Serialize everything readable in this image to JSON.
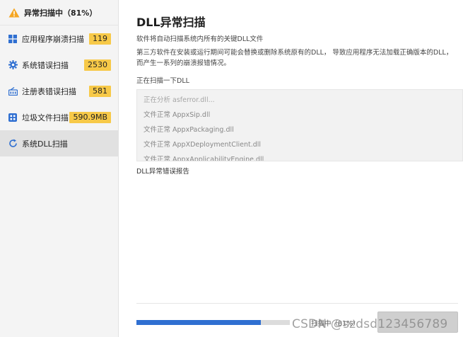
{
  "sidebar": {
    "header": {
      "text": "异常扫描中（81%）"
    },
    "items": [
      {
        "label": "应用程序崩溃扫描",
        "badge": "119",
        "icon": "windows-grid-icon",
        "active": false
      },
      {
        "label": "系统错误扫描",
        "badge": "2530",
        "icon": "gear-icon",
        "active": false
      },
      {
        "label": "注册表错误扫描",
        "badge": "581",
        "icon": "registry-icon",
        "active": false
      },
      {
        "label": "垃圾文件扫描",
        "badge": "590.9MB",
        "icon": "trash-grid-icon",
        "active": false
      },
      {
        "label": "系统DLL扫描",
        "badge": "",
        "icon": "refresh-spinner-icon",
        "active": true
      }
    ]
  },
  "main": {
    "title": "DLL异常扫描",
    "description_line1": "软件将自动扫描系统内所有的关键DLL文件",
    "description_line2": "第三方软件在安装或运行期间可能会替换或删除系统原有的DLL， 导致应用程序无法加载正确版本的DLL，而产生一系列的崩溃报错情况。",
    "scanning_label": "正在扫描一下DLL",
    "log": [
      "正在分析 asferror.dll...",
      "文件正常 AppxSip.dll",
      "文件正常 AppxPackaging.dll",
      "文件正常 AppXDeploymentClient.dll",
      "文件正常 AppxApplicabilityEngine.dll"
    ],
    "report_label": "DLL异常错误报告",
    "progress": {
      "percent": 81,
      "text": "扫描中（81%）"
    },
    "cancel_label": "",
    "watermark": "CSDN @szdsd123456789"
  },
  "colors": {
    "badge": "#f7c948",
    "progress": "#2f6fd1",
    "warning": "#f5a623"
  }
}
